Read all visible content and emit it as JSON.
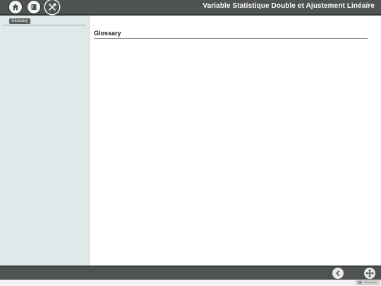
{
  "header": {
    "title": "Variable Statistique Double et Ajustement Linéaire",
    "icons": [
      "home-icon",
      "book-icon",
      "tools-icon"
    ]
  },
  "sidebar": {
    "items": [
      {
        "label": "Glossary",
        "selected": true
      }
    ]
  },
  "main": {
    "page_title": "Glossary"
  },
  "footer": {
    "icons": [
      "back-icon",
      "fullscreen-icon"
    ]
  },
  "colors": {
    "bar": "#4e5250",
    "sidebar": "#deeaea",
    "content": "#ffffff",
    "selected_item": "#575b59"
  }
}
